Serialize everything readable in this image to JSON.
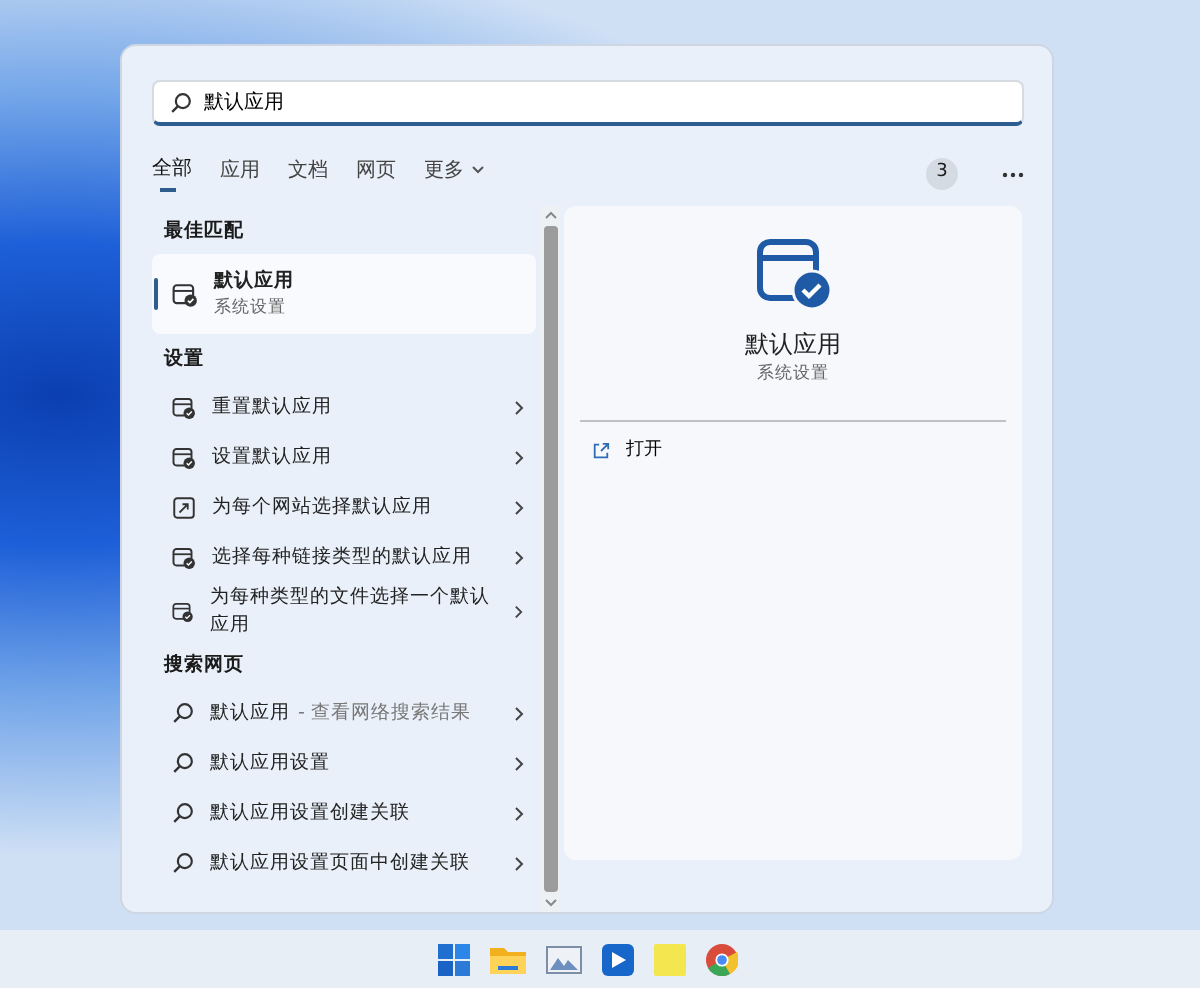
{
  "search": {
    "value": "默认应用"
  },
  "tabs": [
    {
      "label": "全部",
      "selected": true
    },
    {
      "label": "应用",
      "selected": false
    },
    {
      "label": "文档",
      "selected": false
    },
    {
      "label": "网页",
      "selected": false
    }
  ],
  "more_menu": {
    "label": "更多"
  },
  "result_count": "3",
  "sections": [
    {
      "title": "最佳匹配",
      "items": [
        {
          "kind": "best",
          "title": "默认应用",
          "subtitle": "系统设置",
          "selected": true
        }
      ]
    },
    {
      "title": "设置",
      "items": [
        {
          "kind": "setting",
          "title": "重置默认应用",
          "selected": false
        },
        {
          "kind": "setting",
          "title": "设置默认应用",
          "selected": false
        },
        {
          "kind": "site",
          "title": "为每个网站选择默认应用",
          "selected": false
        },
        {
          "kind": "setting",
          "title": "选择每种链接类型的默认应用",
          "selected": false
        },
        {
          "kind": "setting",
          "title": "为每种类型的文件选择一个默认应用",
          "selected": false
        }
      ]
    },
    {
      "title": "搜索网页",
      "items": [
        {
          "kind": "web",
          "title": "默认应用",
          "hint": "- 查看网络搜索结果",
          "selected": false
        },
        {
          "kind": "web",
          "title": "默认应用设置",
          "selected": false
        },
        {
          "kind": "web",
          "title": "默认应用设置创建关联",
          "selected": false
        },
        {
          "kind": "web",
          "title": "默认应用设置页面中创建关联",
          "selected": false
        }
      ]
    }
  ],
  "preview": {
    "title": "默认应用",
    "subtitle": "系统设置",
    "actions": [
      {
        "label": "打开"
      }
    ]
  }
}
